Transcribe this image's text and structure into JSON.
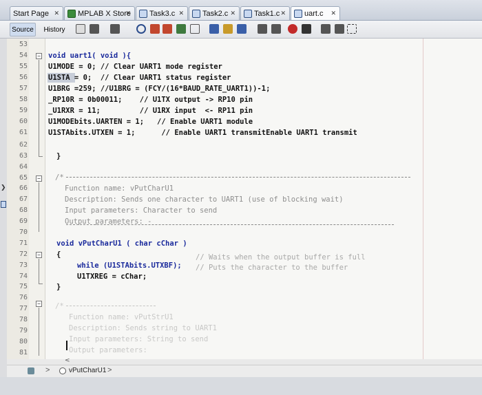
{
  "tabs": [
    {
      "label": "Start Page",
      "active": false
    },
    {
      "label": "MPLAB X Store",
      "active": false
    },
    {
      "label": "Task3.c",
      "active": false
    },
    {
      "label": "Task2.c",
      "active": false
    },
    {
      "label": "Task1.c",
      "active": false
    },
    {
      "label": "uart.c",
      "active": true
    }
  ],
  "toolbar": {
    "source_label": "Source",
    "history_label": "History"
  },
  "line_numbers": [
    "53",
    "54",
    "55",
    "56",
    "57",
    "58",
    "59",
    "60",
    "61",
    "62",
    "63",
    "64",
    "65",
    "66",
    "67",
    "68",
    "69",
    "70",
    "71",
    "72",
    "73",
    "74",
    "75",
    "76",
    "77",
    "78",
    "79",
    "80",
    "81"
  ],
  "code": {
    "l54": "void uart1( void ){",
    "l55": "U1MODE = 0; // Clear UART1 mode register",
    "l56": "U1STA = 0;  // Clear UART1 status register",
    "l57": "U1BRG =259; //U1BRG = (FCY/(16*BAUD_RATE_UART1))-1;",
    "l58": "_RP10R = 0b00011;    // U1TX output -> RP10 pin",
    "l59": "_U1RXR = 11;         // U1RX input  <- RP11 pin",
    "l60": "U1MODEbits.UARTEN = 1;   // Enable UART1 module",
    "l61": "U1STAbits.UTXEN = 1;      // Enable UART1 transmitEnable UART1 transmit",
    "l63": "}",
    "l66": "Function name: vPutCharU1",
    "l67": "Description: Sends one character to UART1 (use of blocking wait)",
    "l68": "Input parameters: Character to send",
    "l69": "Output parameters: -",
    "l71": "void vPutCharU1 ( char cChar )",
    "l72": "{",
    "l73_code": "while (U1STAbits.UTXBF);",
    "l73_comment": "// Waits when the output buffer is full",
    "l74_code": "U1TXREG = cChar;",
    "l74_comment": "// Puts the character to the buffer",
    "l75": "}",
    "l78": "Function name: vPutStrU1",
    "l79": "Description: Sends string to UART1",
    "l80": "Input parameters: String to send",
    "l81": "Output parameters:"
  },
  "navigator": {
    "function_label": "vPutCharU1"
  },
  "colors": {
    "keyword": "#1a2a9c",
    "comment": "#8e8e8e",
    "active_tab": "#fbfcfd"
  }
}
